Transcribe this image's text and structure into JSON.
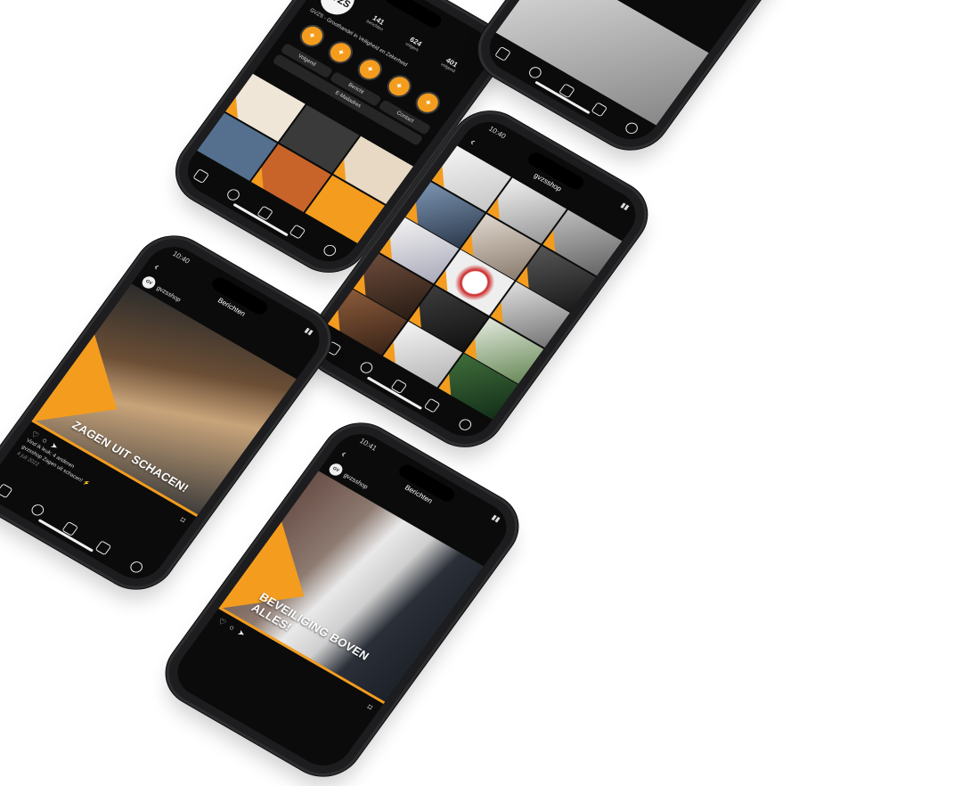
{
  "brand": {
    "accent": "#f39c1e",
    "dark": "#0b0b0b"
  },
  "phone_profile": {
    "username": "gvzsshop",
    "logo_text": "GVZS",
    "stats": [
      {
        "value": "141",
        "label": "berichten"
      },
      {
        "value": "624",
        "label": "volgers"
      },
      {
        "value": "401",
        "label": "volgend"
      }
    ],
    "bio": "GVZS - Groothandel in Veiligheid en Zekerheid",
    "buttons": [
      "Volgend",
      "Bericht",
      "Contact"
    ],
    "extra_button": "E-Mailadres"
  },
  "phone_grid": {
    "time": "10:40",
    "username": "gvzsshop",
    "subtitle": "Berichten"
  },
  "phone_post1": {
    "time": "10:40",
    "username": "gvzsshop",
    "header": "Berichten",
    "headline": "ZAGEN UIT SCHACEN!",
    "likes": "Vind ik leuk: 4 anderen",
    "caption": "gvzsshop Zagen uit schacen! ⚡",
    "date": "4 juli 2022"
  },
  "phone_post2": {
    "time": "10:41",
    "username": "gvzsshop",
    "header": "Berichten",
    "headline": "BEVEILIGING BOVEN ALLES!"
  },
  "phone_topright": {
    "username": "gvzsshop"
  }
}
